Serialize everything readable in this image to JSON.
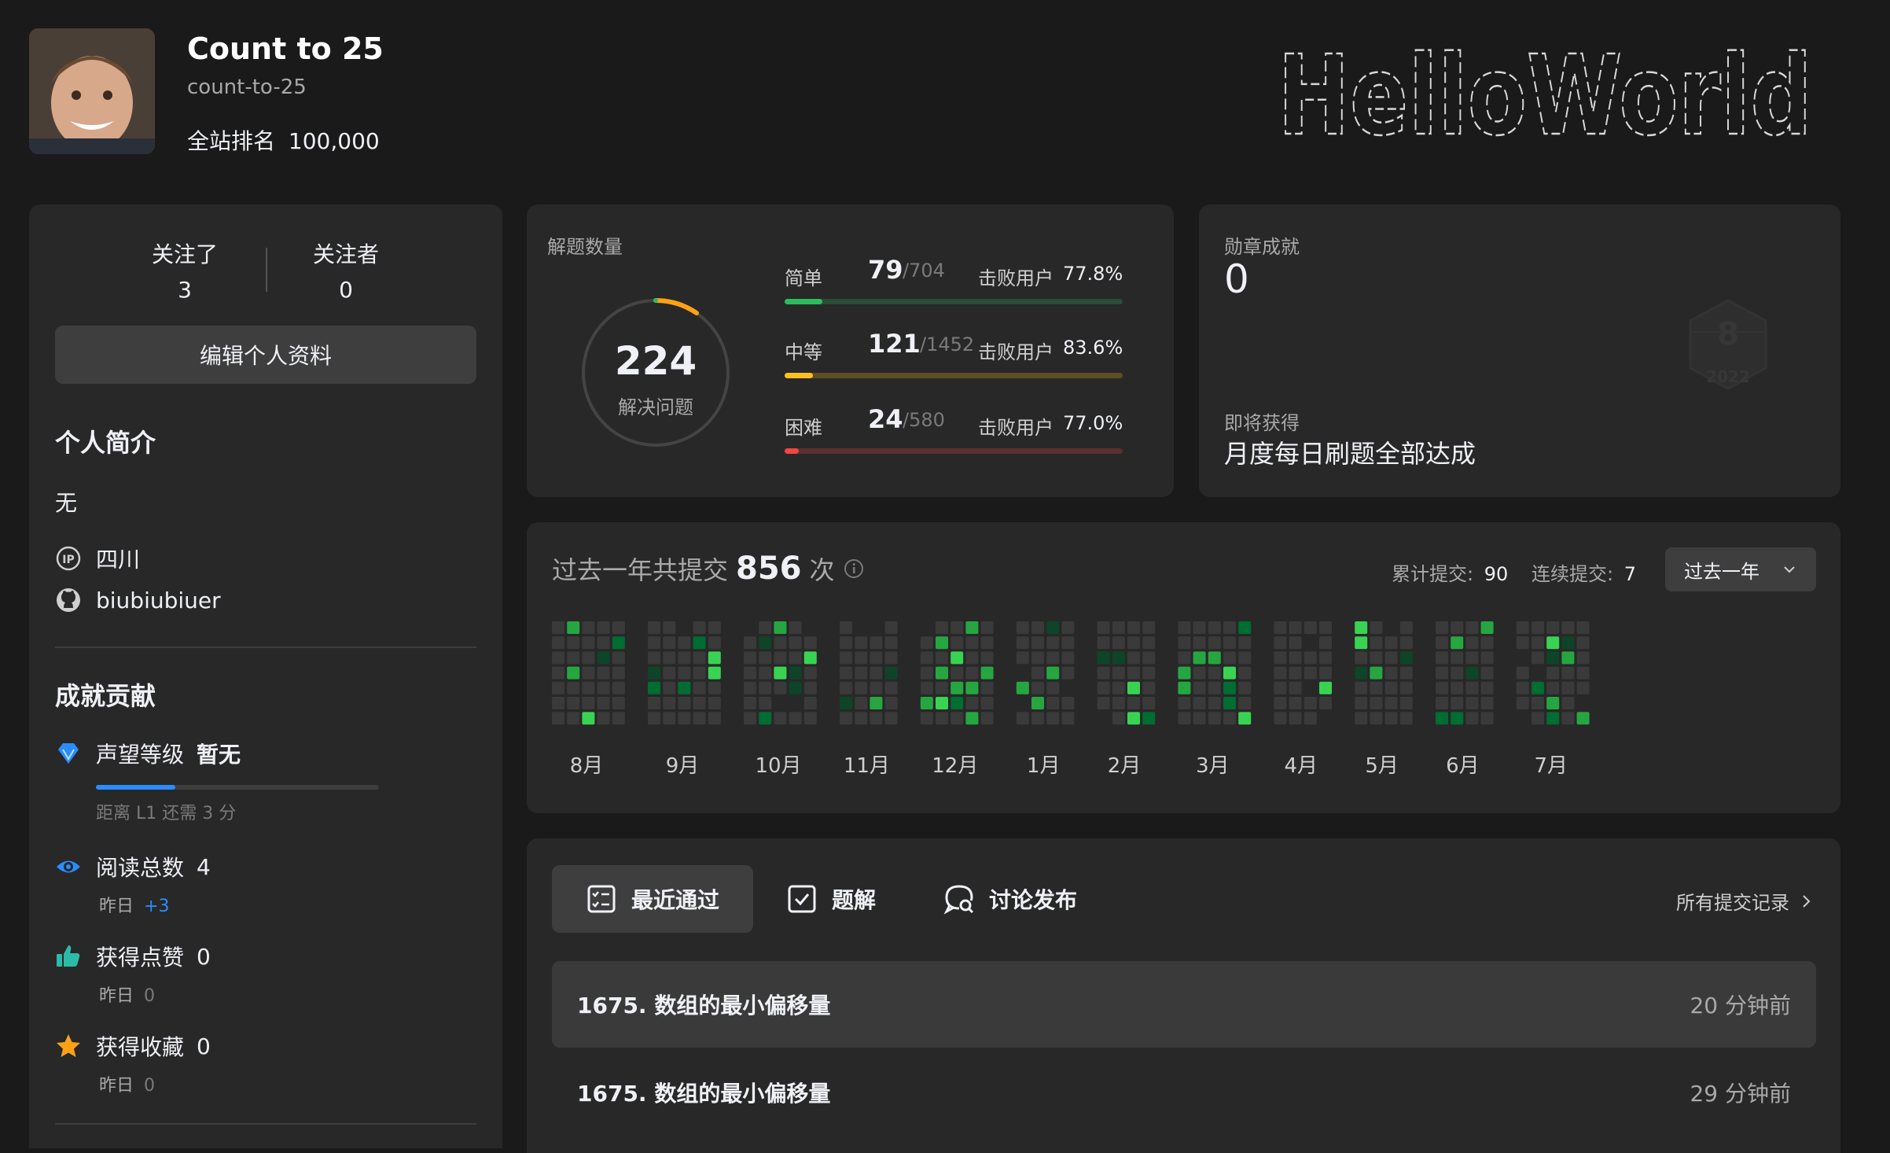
{
  "profile": {
    "name": "Count to 25",
    "username": "count-to-25",
    "rank_label": "全站排名",
    "rank_value": "100,000",
    "banner_text": "HelloWorld"
  },
  "follow": {
    "following_label": "关注了",
    "following_value": "3",
    "followers_label": "关注者",
    "followers_value": "0"
  },
  "edit_button": "编辑个人资料",
  "bio": {
    "title": "个人简介",
    "text": "无",
    "location": "四川",
    "github": "biubiubiuer"
  },
  "achievements": {
    "title": "成就贡献",
    "reputation_label": "声望等级",
    "reputation_value": "暂无",
    "reputation_progress": 0.28,
    "reputation_hint": "距离 L1 还需 3 分",
    "reads_label": "阅读总数",
    "reads_value": "4",
    "reads_sub_label": "昨日",
    "reads_sub_value": "+3",
    "likes_label": "获得点赞",
    "likes_value": "0",
    "likes_sub_label": "昨日",
    "likes_sub_value": "0",
    "favs_label": "获得收藏",
    "favs_value": "0",
    "favs_sub_label": "昨日",
    "favs_sub_value": "0"
  },
  "solved": {
    "title": "解题数量",
    "total": "224",
    "total_label": "解决问题",
    "rows": [
      {
        "label": "简单",
        "value": "79",
        "total": "/704",
        "beat_label": "击败用户",
        "beat": "77.8%",
        "fraction": 0.112,
        "color": "#2cbb5d"
      },
      {
        "label": "中等",
        "value": "121",
        "total": "/1452",
        "beat_label": "击败用户",
        "beat": "83.6%",
        "fraction": 0.083,
        "color": "#ffc01e"
      },
      {
        "label": "困难",
        "value": "24",
        "total": "/580",
        "beat_label": "击败用户",
        "beat": "77.0%",
        "fraction": 0.041,
        "color": "#ef4743"
      }
    ]
  },
  "badges": {
    "title": "勋章成就",
    "count": "0",
    "upcoming_label": "即将获得",
    "upcoming_name": "月度每日刷题全部达成",
    "badge_number": "8",
    "badge_year": "2022"
  },
  "heatmap": {
    "title_prefix": "过去一年共提交",
    "count": "856",
    "title_suffix": "次",
    "total_label": "累计提交:",
    "total_value": "90",
    "streak_label": "连续提交:",
    "streak_value": "7",
    "range_select": "过去一年",
    "months": [
      "8月",
      "9月",
      "10月",
      "11月",
      "12月",
      "1月",
      "2月",
      "3月",
      "4月",
      "5月",
      "6月",
      "7月"
    ]
  },
  "tabs": {
    "recent": "最近通过",
    "solutions": "题解",
    "discuss": "讨论发布",
    "all_submissions": "所有提交记录"
  },
  "recent": [
    {
      "title": "1675. 数组的最小偏移量",
      "time": "20 分钟前"
    },
    {
      "title": "1675. 数组的最小偏移量",
      "time": "29 分钟前"
    }
  ],
  "colors": {
    "bg": "#1a1a1a",
    "card": "#282828",
    "easy": "#2cbb5d",
    "medium": "#ffc01e",
    "hard": "#ef4743",
    "accent": "#2a8cff"
  }
}
